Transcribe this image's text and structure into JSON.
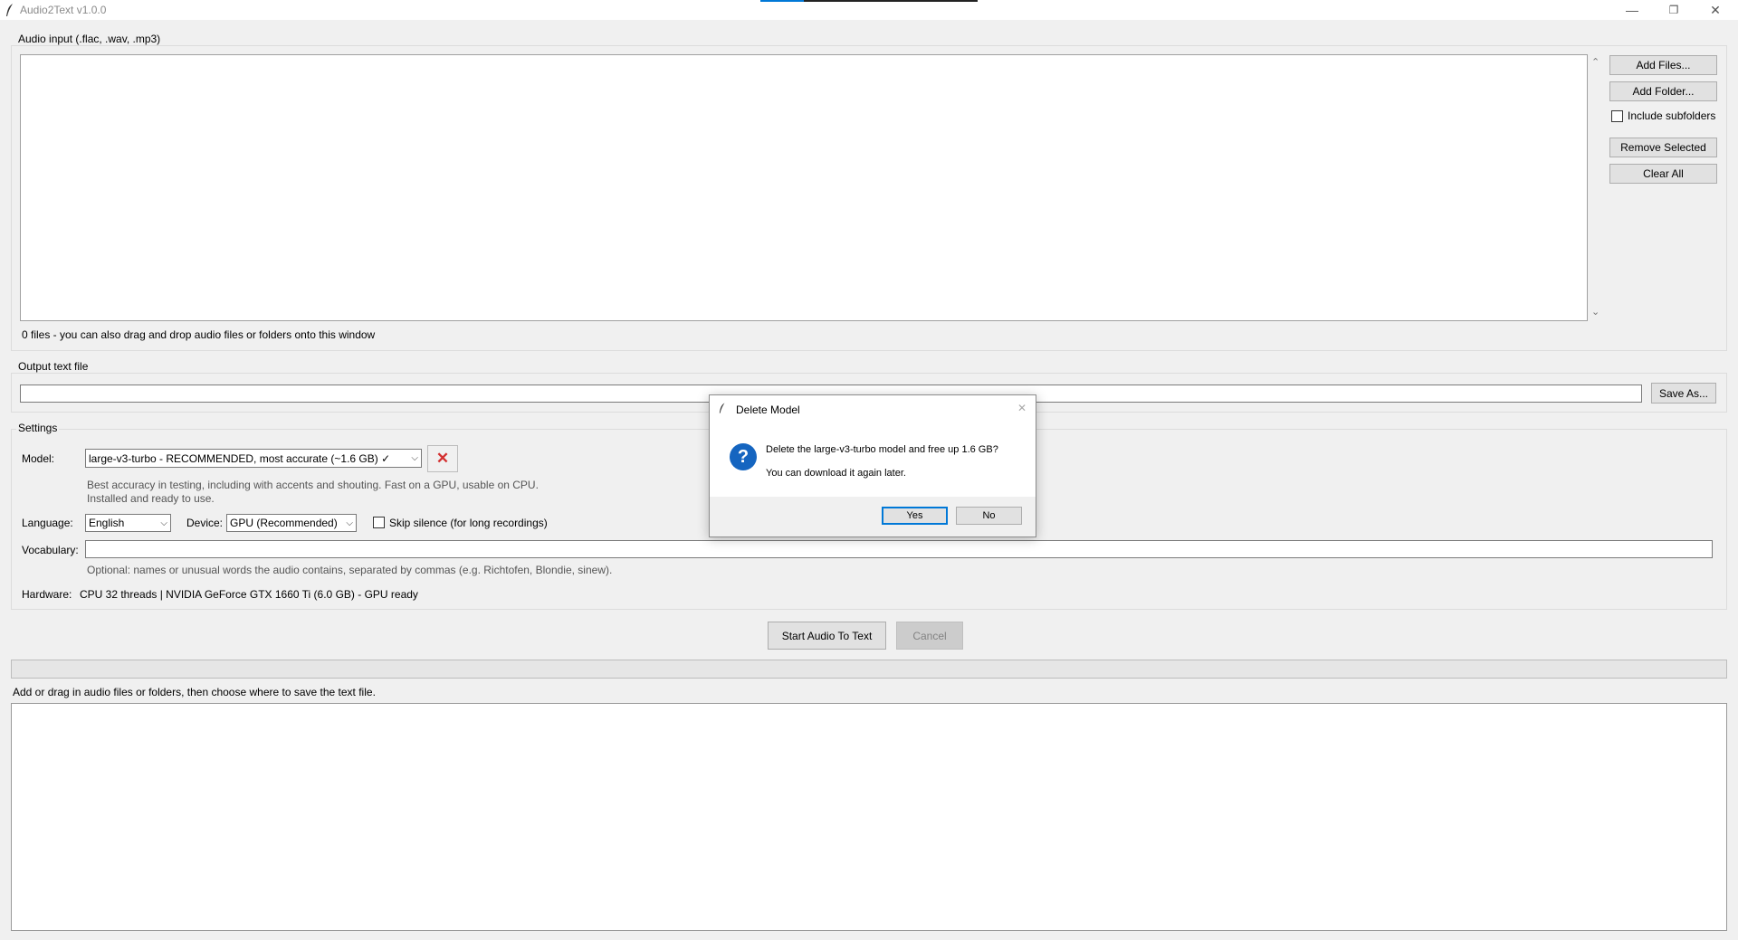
{
  "window": {
    "title": "Audio2Text v1.0.0",
    "controls": {
      "minimize": "—",
      "restore": "❐",
      "close": "✕"
    }
  },
  "audio_input": {
    "label": "Audio input (.flac, .wav, .mp3)",
    "buttons": {
      "add_files": "Add Files...",
      "add_folder": "Add Folder...",
      "remove_selected": "Remove Selected",
      "clear_all": "Clear All"
    },
    "include_subfolders": {
      "label": "Include subfolders",
      "checked": false
    },
    "status": "0 files  -  you can also drag and drop audio files or folders onto this window",
    "scroll_up": "⌃",
    "scroll_down": "⌄"
  },
  "output": {
    "label": "Output text file",
    "value": "",
    "save_as": "Save As..."
  },
  "settings": {
    "label": "Settings",
    "model": {
      "label": "Model:",
      "value": "large-v3-turbo  -  RECOMMENDED, most accurate (~1.6 GB)  ✓",
      "delete_icon": "✕",
      "desc1": "Best accuracy in testing, including with accents and shouting. Fast on a GPU, usable on CPU.",
      "desc2": "Installed and ready to use."
    },
    "language": {
      "label": "Language:",
      "value": "English"
    },
    "device": {
      "label": "Device:",
      "value": "GPU (Recommended)"
    },
    "skip_silence": {
      "label": "Skip silence (for long recordings)",
      "checked": false
    },
    "vocabulary": {
      "label": "Vocabulary:",
      "value": "",
      "hint": "Optional: names or unusual words the audio contains, separated by commas (e.g. Richtofen, Blondie, sinew)."
    },
    "hardware": {
      "label": "Hardware:",
      "value": "CPU 32 threads  |  NVIDIA GeForce GTX 1660 Ti (6.0 GB) - GPU ready"
    }
  },
  "actions": {
    "start": "Start Audio To Text",
    "cancel": "Cancel"
  },
  "progress": {
    "value": 0
  },
  "log": {
    "message": "Add or drag in audio files or folders, then choose where to save the text file."
  },
  "dialog": {
    "title": "Delete Model",
    "close": "✕",
    "icon": "?",
    "line1": "Delete the large-v3-turbo model and free up 1.6 GB?",
    "line2": "You can download it again later.",
    "yes": "Yes",
    "no": "No"
  },
  "colors": {
    "accent": "#0078d7",
    "delete_red": "#d32f2f",
    "question_blue": "#1565c0"
  }
}
